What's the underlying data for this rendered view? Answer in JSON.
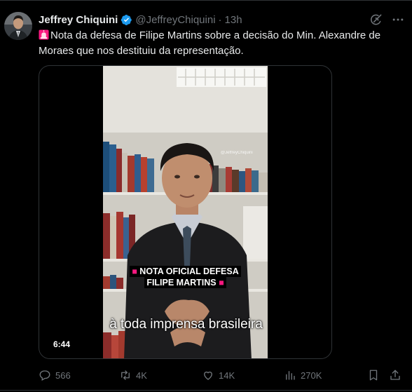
{
  "author": {
    "name": "Jeffrey Chiquini",
    "handle": "@JeffreyChiquini",
    "time": "13h",
    "verified": true
  },
  "tweet": {
    "text": "Nota da defesa de Filipe Martins sobre a decisão do Min. Alexandre de Moraes que nos destituiu da representação."
  },
  "video": {
    "overlay_line1": "NOTA OFICIAL DEFESA",
    "overlay_line2": "FILIPE MARTINS",
    "caption": "à toda imprensa brasileira",
    "duration": "6:44",
    "watermark": "@JeffreyChiquini"
  },
  "metrics": {
    "replies": "566",
    "reposts": "4K",
    "likes": "14K",
    "views": "270K"
  },
  "colors": {
    "background": "#000000",
    "text": "#e7e9ea",
    "muted": "#71767b",
    "border": "#2f3336",
    "verified": "#1d9bf0",
    "siren": "#f91880"
  },
  "icons": [
    "verified-badge-icon",
    "grok-icon",
    "more-icon",
    "siren-icon",
    "reply-icon",
    "repost-icon",
    "like-icon",
    "views-icon",
    "bookmark-icon",
    "share-icon"
  ]
}
